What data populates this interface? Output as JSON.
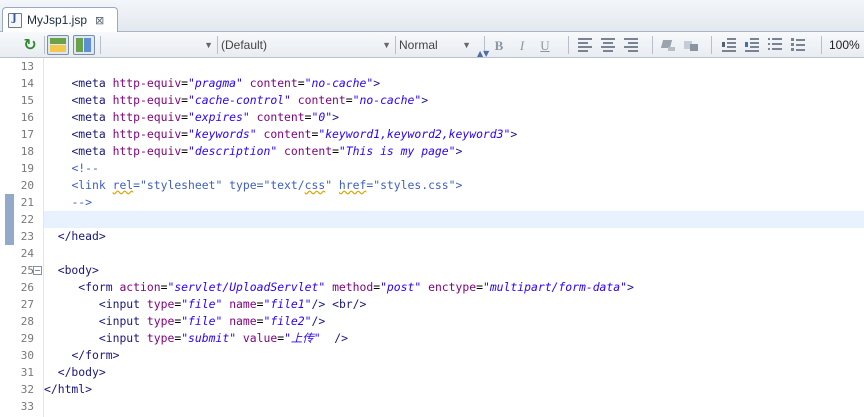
{
  "tab": {
    "label": "MyJsp1.jsp",
    "close": "⊠"
  },
  "toolbar": {
    "refresh_glyph": "↻",
    "combo_blank": "",
    "font_combo": "(Default)",
    "style_combo": "Normal",
    "bold": "B",
    "italic": "I",
    "underline": "U",
    "zoom": "100%"
  },
  "editor": {
    "lines": [
      {
        "n": "13",
        "html": ""
      },
      {
        "n": "14",
        "html": "    <span class=\"t\">&lt;meta</span> <span class=\"a\">http-equiv</span>=<span class=\"v\">\"pragma\"</span> <span class=\"a\">content</span>=<span class=\"v\">\"no-cache\"</span><span class=\"t\">&gt;</span>"
      },
      {
        "n": "15",
        "html": "    <span class=\"t\">&lt;meta</span> <span class=\"a\">http-equiv</span>=<span class=\"v\">\"cache-control\"</span> <span class=\"a\">content</span>=<span class=\"v\">\"no-cache\"</span><span class=\"t\">&gt;</span>"
      },
      {
        "n": "16",
        "html": "    <span class=\"t\">&lt;meta</span> <span class=\"a\">http-equiv</span>=<span class=\"v\">\"expires\"</span> <span class=\"a\">content</span>=<span class=\"v\">\"0\"</span><span class=\"t\">&gt;</span>"
      },
      {
        "n": "17",
        "html": "    <span class=\"t\">&lt;meta</span> <span class=\"a\">http-equiv</span>=<span class=\"v\">\"keywords\"</span> <span class=\"a\">content</span>=<span class=\"v\">\"keyword1,keyword2,keyword3\"</span><span class=\"t\">&gt;</span>"
      },
      {
        "n": "18",
        "html": "    <span class=\"t\">&lt;meta</span> <span class=\"a\">http-equiv</span>=<span class=\"v\">\"description\"</span> <span class=\"a\">content</span>=<span class=\"v\">\"This is my page\"</span><span class=\"t\">&gt;</span>"
      },
      {
        "n": "19",
        "html": "    <span class=\"c\">&lt;!--</span>"
      },
      {
        "n": "20",
        "html": "    <span class=\"c\">&lt;link <span class=\"sq\">rel</span>=\"stylesheet\" type=\"text/<span class=\"sq\">css</span>\" <span class=\"sq\">href</span>=\"styles.css\"&gt;</span>"
      },
      {
        "n": "21",
        "html": "    <span class=\"c\">--&gt;</span>"
      },
      {
        "n": "22",
        "html": ""
      },
      {
        "n": "23",
        "html": "  <span class=\"t\">&lt;/head&gt;</span>"
      },
      {
        "n": "24",
        "html": ""
      },
      {
        "n": "25",
        "html": "  <span class=\"t\">&lt;body&gt;</span>"
      },
      {
        "n": "26",
        "html": "     <span class=\"t\">&lt;form</span> <span class=\"a\">action</span>=<span class=\"v\">\"servlet/UploadServlet\"</span> <span class=\"a\">method</span>=<span class=\"v\">\"post\"</span> <span class=\"a\">enctype</span>=<span class=\"v\">\"multipart/form-data\"</span><span class=\"t\">&gt;</span>"
      },
      {
        "n": "27",
        "html": "        <span class=\"t\">&lt;input</span> <span class=\"a\">type</span>=<span class=\"v\">\"file\"</span> <span class=\"a\">name</span>=<span class=\"v\">\"file1\"</span><span class=\"t\">/&gt;</span> <span class=\"t\">&lt;br/&gt;</span>"
      },
      {
        "n": "28",
        "html": "        <span class=\"t\">&lt;input</span> <span class=\"a\">type</span>=<span class=\"v\">\"file\"</span> <span class=\"a\">name</span>=<span class=\"v\">\"file2\"</span><span class=\"t\">/&gt;</span>"
      },
      {
        "n": "29",
        "html": "        <span class=\"t\">&lt;input</span> <span class=\"a\">type</span>=<span class=\"v\">\"submit\"</span> <span class=\"a\">value</span>=<span class=\"v\">\"上传\"</span>  <span class=\"t\">/&gt;</span>"
      },
      {
        "n": "30",
        "html": "    <span class=\"t\">&lt;/form&gt;</span>"
      },
      {
        "n": "31",
        "html": "  <span class=\"t\">&lt;/body&gt;</span>"
      },
      {
        "n": "32",
        "html": "<span class=\"t\">&lt;/html&gt;</span>"
      },
      {
        "n": "33",
        "html": ""
      }
    ],
    "current_line": "22",
    "fold_line": "25",
    "fold_glyph": "−",
    "changed_lines": [
      "21",
      "22",
      "23"
    ]
  }
}
